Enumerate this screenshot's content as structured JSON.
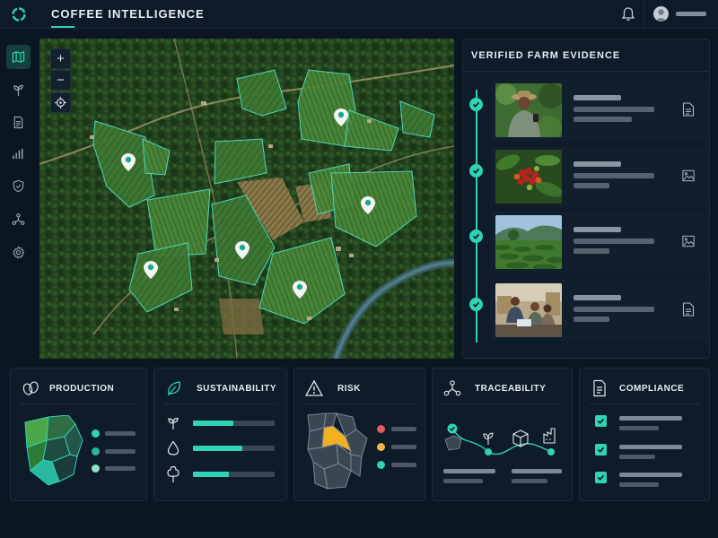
{
  "header": {
    "app_title": "COFFEE INTELLIGENCE",
    "icons": [
      "logo-ring-icon",
      "bell-icon",
      "avatar"
    ]
  },
  "sidebar": {
    "items": [
      {
        "icon": "map-icon",
        "active": true
      },
      {
        "icon": "sprout-icon",
        "active": false
      },
      {
        "icon": "document-icon",
        "active": false
      },
      {
        "icon": "bar-chart-icon",
        "active": false
      },
      {
        "icon": "shield-icon",
        "active": false
      },
      {
        "icon": "network-icon",
        "active": false
      },
      {
        "icon": "gear-icon",
        "active": false
      }
    ]
  },
  "map": {
    "controls": {
      "zoom_in": "+",
      "zoom_out": "−",
      "locate": "crosshair-icon"
    }
  },
  "evidence": {
    "title": "VERIFIED FARM EVIDENCE",
    "items": [
      {
        "photo": "farmer-with-phone",
        "type": "document-icon",
        "verified": true
      },
      {
        "photo": "coffee-cherries",
        "type": "image-icon",
        "verified": true
      },
      {
        "photo": "plantation-landscape",
        "type": "image-icon",
        "verified": true
      },
      {
        "photo": "warehouse-team",
        "type": "document-icon",
        "verified": true
      }
    ]
  },
  "cards": {
    "production": {
      "title": "PRODUCTION",
      "icon": "coffee-bean-icon"
    },
    "sustainability": {
      "title": "SUSTAINABILITY",
      "icon": "leaf-icon",
      "bars": [
        {
          "icon": "sprout-icon",
          "level": 0.49
        },
        {
          "icon": "water-drop-icon",
          "level": 0.6
        },
        {
          "icon": "tree-icon",
          "level": 0.44
        }
      ]
    },
    "risk": {
      "title": "RISK",
      "icon": "warning-icon",
      "levels": [
        {
          "color": "#e25a5a"
        },
        {
          "color": "#f0b63f"
        },
        {
          "color": "#2fd3b5"
        }
      ]
    },
    "traceability": {
      "title": "TRACEABILITY",
      "icon": "network-icon",
      "steps": [
        "origin-icon",
        "sprout-icon",
        "package-icon",
        "factory-icon"
      ]
    },
    "compliance": {
      "title": "COMPLIANCE",
      "icon": "document-icon",
      "checks": [
        true,
        true,
        true
      ]
    }
  },
  "colors": {
    "accent": "#2fd3b5",
    "background": "#0b1622",
    "panel": "#0e1b28"
  }
}
